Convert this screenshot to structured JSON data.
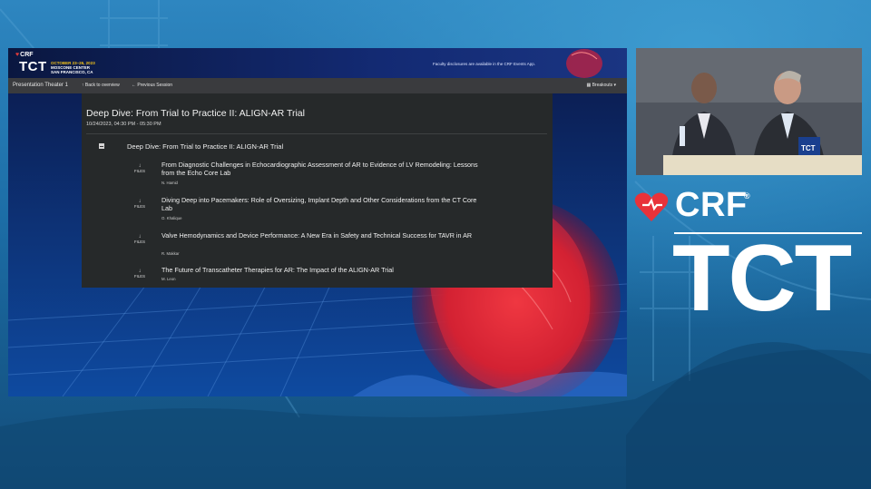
{
  "header": {
    "crf_logo": "CRF",
    "tct_logo": "TCT",
    "event_dates": "OCTOBER 23–26, 2023",
    "event_venue": "MOSCONE CENTER",
    "event_city": "SAN FRANCISCO, CA",
    "disclosure": "Faculty disclosures are available in the CRF Events App."
  },
  "navbar": {
    "title": "Presentation Theater 1",
    "back_label": "Back to overview",
    "prev_label": "Previous Session",
    "breakouts_label": "Breakouts ▾"
  },
  "session": {
    "title": "Deep Dive: From Trial to Practice II: ALIGN-AR Trial",
    "time": "10/24/2023, 04:30 PM - 05:30 PM",
    "sub_title": "Deep Dive: From Trial to Practice II: ALIGN-AR Trial",
    "files_label": "FILES",
    "talks": [
      {
        "title": "From Diagnostic Challenges in Echocardiographic Assessment of AR to Evidence of LV Remodeling: Lessons from the Echo Core Lab",
        "speaker": "N. Hamid"
      },
      {
        "title": "Diving Deep into Pacemakers: Role of Oversizing, Implant Depth and Other Considerations from the CT Core Lab",
        "speaker": "O. Khalique"
      },
      {
        "title": "Valve Hemodynamics and Device Performance: A New Era in Safety and Technical Success for TAVR in AR",
        "speaker": "R. Makkar"
      },
      {
        "title": "The Future of Transcatheter Therapies for AR: The Impact of the ALIGN-AR Trial",
        "speaker": "M. Leon"
      }
    ]
  },
  "video": {
    "podium_logo": "TCT"
  },
  "branding": {
    "crf": "CRF",
    "registered": "®",
    "tct": "TCT"
  },
  "colors": {
    "background": "#1c6da6",
    "screen_header": "#132a73",
    "navbar": "#3a3b3e",
    "panel": "#26292a",
    "accent_red": "#e23a3a",
    "event_yellow": "#f2c21a"
  },
  "icons": {
    "files": "download-arrow-icon",
    "collapse": "minus-square-icon",
    "back": "arrow-up-icon",
    "prev": "arrow-left-icon",
    "breakouts": "grid-icon"
  }
}
